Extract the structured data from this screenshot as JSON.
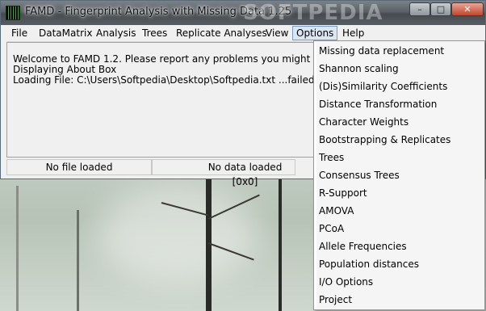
{
  "window": {
    "title": "FAMD - Fingerprint Analysis with Missing Data 1.25",
    "watermark": "SOFTPEDIA"
  },
  "controls": {
    "minimize": "–",
    "maximize": "□",
    "close": "✕"
  },
  "menu": {
    "items": [
      "File",
      "DataMatrix",
      "Analysis",
      "Trees",
      "Replicate Analyses",
      "View",
      "Options",
      "Help"
    ],
    "active": "Options"
  },
  "log": [
    "Welcome to FAMD 1.2. Please report any problems you might experience",
    "Displaying About Box",
    "Loading File: C:\\Users\\Softpedia\\Desktop\\Softpedia.txt ...failed."
  ],
  "status": {
    "left": "No file loaded",
    "right": "No data loaded [0x0]"
  },
  "options_menu": [
    "Missing data replacement",
    "Shannon scaling",
    "(Dis)Similarity Coefficients",
    "Distance Transformation",
    "Character Weights",
    "Bootstrapping & Replicates",
    "Trees",
    "Consensus Trees",
    "R-Support",
    "AMOVA",
    "PCoA",
    "Allele Frequencies",
    "Population distances",
    "I/O Options",
    "Project"
  ]
}
